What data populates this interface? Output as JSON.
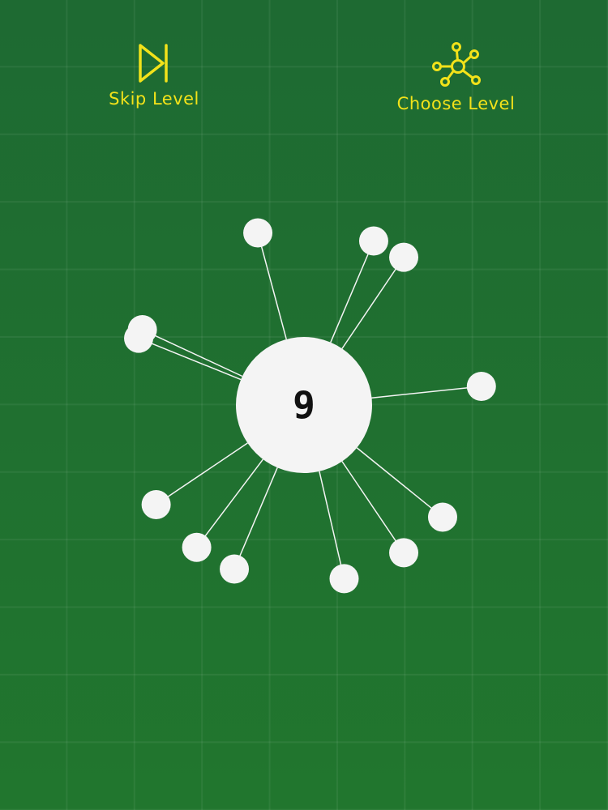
{
  "colors": {
    "accent": "#f2e21a",
    "pin": "#f4f4f4",
    "hub": "#f4f4f4",
    "text_dark": "#111111",
    "background": "#1e6b2f"
  },
  "toolbar": {
    "skip_label": "Skip Level",
    "skip_icon": "skip-forward-icon",
    "choose_label": "Choose Level",
    "choose_icon": "network-hub-icon"
  },
  "game": {
    "level_number": "9",
    "pin_count": 12,
    "pin_angles_deg": [
      -105,
      -67,
      -56,
      -155,
      -158,
      -6,
      39,
      56,
      77,
      113,
      127,
      146
    ]
  }
}
